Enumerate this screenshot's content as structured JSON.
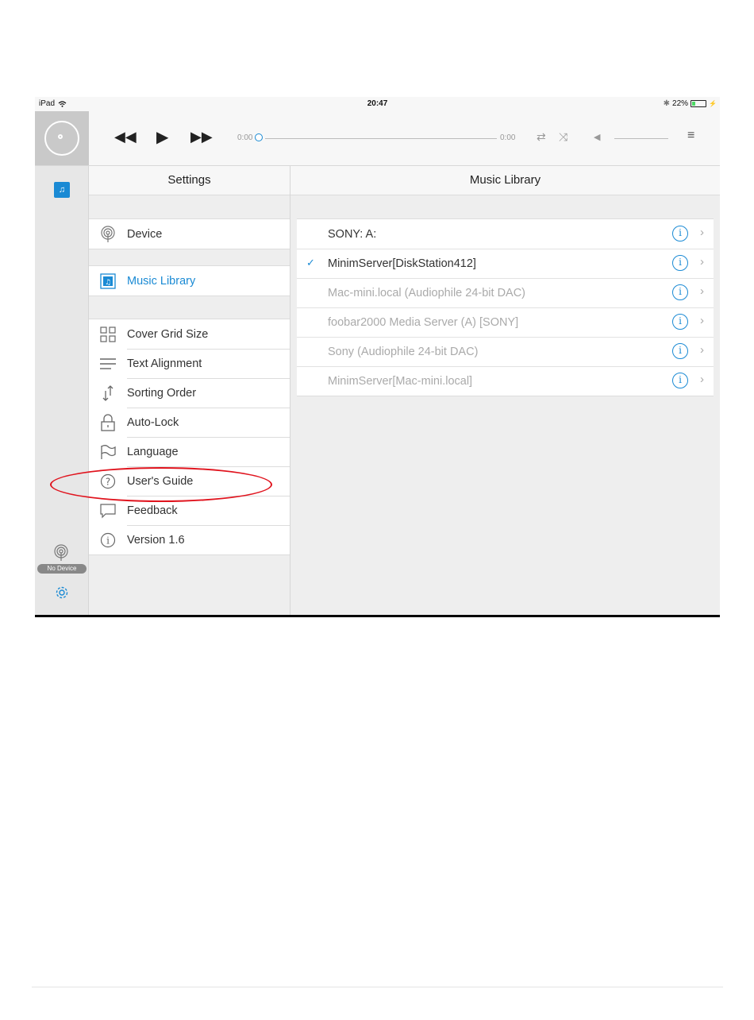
{
  "status_bar": {
    "device": "iPad",
    "time": "20:47",
    "battery": "22%"
  },
  "player": {
    "elapsed": "0:00",
    "remaining": "0:00",
    "progress": 0
  },
  "rail": {
    "no_device_badge": "No Device"
  },
  "settings": {
    "title": "Settings",
    "device_label": "Device",
    "music_library_label": "Music Library",
    "items": [
      {
        "label": "Cover Grid Size",
        "icon": "grid-icon"
      },
      {
        "label": "Text Alignment",
        "icon": "align-icon"
      },
      {
        "label": "Sorting Order",
        "icon": "sort-icon"
      },
      {
        "label": "Auto-Lock",
        "icon": "lock-icon"
      },
      {
        "label": "Language",
        "icon": "flag-icon"
      },
      {
        "label": "User's Guide",
        "icon": "help-icon"
      },
      {
        "label": "Feedback",
        "icon": "chat-icon"
      },
      {
        "label": "Version 1.6",
        "icon": "info-icon"
      }
    ]
  },
  "library": {
    "title": "Music Library",
    "servers": [
      {
        "name": "SONY: A:",
        "selected": false,
        "available": true
      },
      {
        "name": "MinimServer[DiskStation412]",
        "selected": true,
        "available": true
      },
      {
        "name": "Mac-mini.local (Audiophile 24-bit DAC)",
        "selected": false,
        "available": false
      },
      {
        "name": "foobar2000 Media Server (A) [SONY]",
        "selected": false,
        "available": false
      },
      {
        "name": "Sony (Audiophile 24-bit DAC)",
        "selected": false,
        "available": false
      },
      {
        "name": "MinimServer[Mac-mini.local]",
        "selected": false,
        "available": false
      }
    ]
  },
  "colors": {
    "accent": "#1a8ad4",
    "annotation": "#e0141e"
  }
}
